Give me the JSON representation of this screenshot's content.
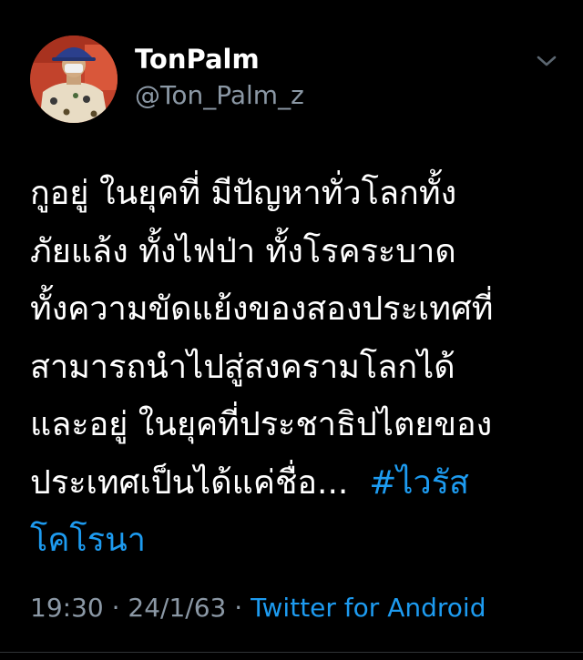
{
  "user": {
    "display_name": "TonPalm",
    "handle": "@Ton_Palm_z"
  },
  "tweet": {
    "lines": [
      "กูอยู่ ในยุคที่ มีปัญหาทั่วโลกทั้ง",
      "ภัยแล้ง ทั้งไฟป่า ทั้งโรคระบาด",
      "ทั้งความขัดแย้งของสองประเทศที่",
      "สามารถนำไปสู่สงครามโลกได้",
      "และอยู่ ในยุคที่ประชาธิปไตยของ",
      "ประเทศเป็นได้แค่ชื่อ...  "
    ],
    "hashtag_part1": "#ไวรัส",
    "hashtag_part2": "โคโรนา"
  },
  "meta": {
    "time": "19:30",
    "separator": " · ",
    "date": "24/1/63",
    "source": "Twitter for Android"
  },
  "icons": {
    "caret": "chevron-down-icon"
  },
  "colors": {
    "background": "#000000",
    "text": "#ffffff",
    "secondary": "#8b98a5",
    "accent": "#1d9bf0"
  }
}
